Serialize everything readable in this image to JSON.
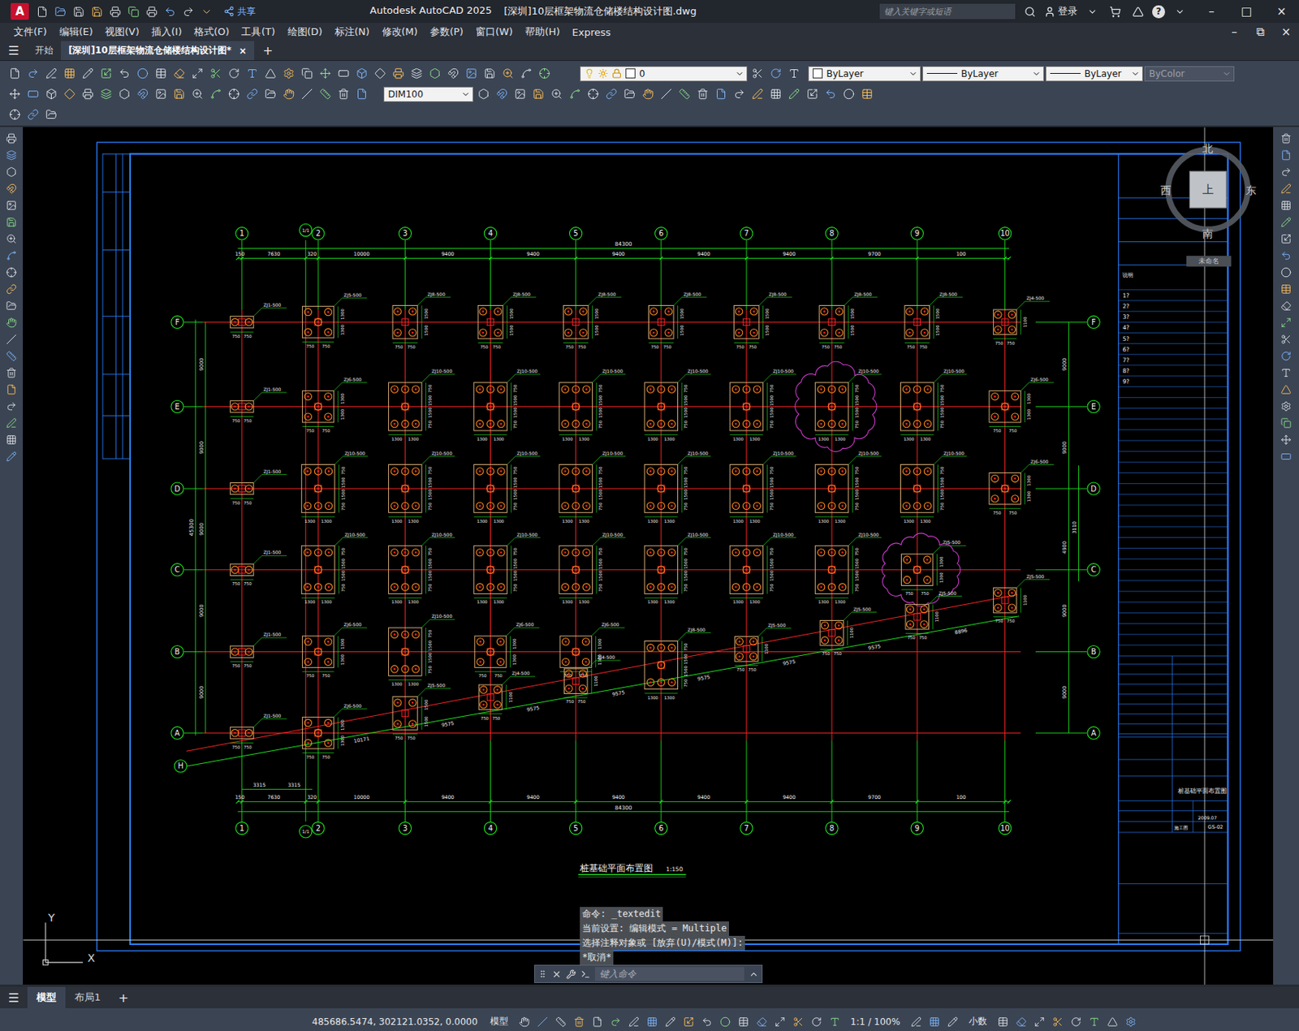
{
  "window": {
    "logo": "A",
    "app": "Autodesk AutoCAD 2025",
    "title": "[深圳]10层框架物流仓储楼结构设计图.dwg",
    "share": "共享",
    "search_placeholder": "键入关键字或短语",
    "login": "登录",
    "help": "?",
    "controls": [
      "–",
      "□",
      "×"
    ]
  },
  "menu": {
    "items": [
      "文件(F)",
      "编辑(E)",
      "视图(V)",
      "插入(I)",
      "格式(O)",
      "工具(T)",
      "绘图(D)",
      "标注(N)",
      "修改(M)",
      "参数(P)",
      "窗口(W)",
      "帮助(H)",
      "Express"
    ],
    "controls": [
      "–",
      "⧉",
      "×"
    ]
  },
  "doc_tabs": {
    "menu_glyph": "☰",
    "tabs": [
      {
        "label": "开始",
        "selected": false,
        "closable": false
      },
      {
        "label": "[深圳]10层框架物流仓储楼结构设计图*",
        "selected": true,
        "closable": true
      }
    ],
    "close_glyph": "×",
    "add_glyph": "+"
  },
  "properties": {
    "layer": "0",
    "color": "ByLayer",
    "linetype": "ByLayer",
    "lineweight": "ByLayer",
    "plot_style": {
      "label": "ByColor",
      "disabled": true
    },
    "dim_style": "DIM100"
  },
  "drawing": {
    "columns": [
      "1",
      "1/1",
      "2",
      "3",
      "4",
      "5",
      "6",
      "7",
      "8",
      "9",
      "10"
    ],
    "rows": [
      "F",
      "E",
      "D",
      "C",
      "B",
      "A"
    ],
    "slope_row": "H",
    "top_total": "84300",
    "top_dims": [
      "150",
      "7630",
      "320",
      "10000",
      "9400",
      "9400",
      "9400",
      "9400",
      "9400",
      "9700",
      "100"
    ],
    "bottom_total": "84300",
    "bottom_dims": [
      "150",
      "7630",
      "320",
      "10000",
      "9400",
      "9400",
      "9400",
      "9400",
      "9400",
      "9700",
      "100"
    ],
    "bottom_extra": [
      "3315",
      "3315"
    ],
    "left_total": "45300",
    "left_dims": [
      "9000",
      "9000",
      "9000",
      "9000",
      "9000"
    ],
    "right_dims": [
      "9000",
      "9000",
      "4900",
      "9000",
      "9000"
    ],
    "right_extra": "3110",
    "slope_dims": [
      "10171",
      "9575",
      "9575",
      "9575",
      "9575",
      "9575",
      "9575",
      "8896"
    ],
    "title": "桩基础平面布置图",
    "scale": "1:150",
    "cap_types": {
      "small": {
        "bottom": [
          "750",
          "750"
        ],
        "side": []
      },
      "four": {
        "bottom": [
          "750",
          "750"
        ],
        "side": [
          "1500",
          "1500"
        ]
      },
      "sq": {
        "bottom": [
          "750",
          "750"
        ],
        "side": [
          "1300",
          "1300"
        ]
      },
      "tall": {
        "bottom": [
          "1300",
          "1300"
        ],
        "side": [
          "750",
          "1500",
          "1500",
          "750"
        ]
      },
      "small4": {
        "bottom": [
          "750",
          "750"
        ],
        "side": [
          "1100"
        ]
      }
    },
    "caps": [
      {
        "col": "1",
        "row": "F",
        "kind": "small",
        "label": "ZJ1-500",
        "marked": false
      },
      {
        "col": "2",
        "row": "F",
        "kind": "sq",
        "label": "ZJ5-500",
        "marked": false
      },
      {
        "col": "3",
        "row": "F",
        "kind": "four",
        "label": "ZJ8-500",
        "marked": false
      },
      {
        "col": "4",
        "row": "F",
        "kind": "four",
        "label": "ZJ8-500",
        "marked": false
      },
      {
        "col": "5",
        "row": "F",
        "kind": "four",
        "label": "ZJ8-500",
        "marked": false
      },
      {
        "col": "6",
        "row": "F",
        "kind": "four",
        "label": "ZJ8-500",
        "marked": false
      },
      {
        "col": "7",
        "row": "F",
        "kind": "four",
        "label": "ZJ8-500",
        "marked": false
      },
      {
        "col": "8",
        "row": "F",
        "kind": "four",
        "label": "ZJ8-500",
        "marked": false
      },
      {
        "col": "9",
        "row": "F",
        "kind": "four",
        "label": "ZJ8-500",
        "marked": false
      },
      {
        "col": "10",
        "row": "F",
        "kind": "small4",
        "label": "ZJ4-500",
        "marked": false
      },
      {
        "col": "1",
        "row": "E",
        "kind": "small",
        "label": "ZJ1-500",
        "marked": false
      },
      {
        "col": "2",
        "row": "E",
        "kind": "sq",
        "label": "ZJ6-500",
        "marked": false
      },
      {
        "col": "3",
        "row": "E",
        "kind": "tall",
        "label": "ZJ10-500",
        "marked": false
      },
      {
        "col": "4",
        "row": "E",
        "kind": "tall",
        "label": "ZJ10-500",
        "marked": false
      },
      {
        "col": "5",
        "row": "E",
        "kind": "tall",
        "label": "ZJ10-500",
        "marked": false
      },
      {
        "col": "6",
        "row": "E",
        "kind": "tall",
        "label": "ZJ10-500",
        "marked": false
      },
      {
        "col": "7",
        "row": "E",
        "kind": "tall",
        "label": "ZJ10-500",
        "marked": false
      },
      {
        "col": "8",
        "row": "E",
        "kind": "tall",
        "label": "ZJ10-500",
        "marked": true
      },
      {
        "col": "9",
        "row": "E",
        "kind": "tall",
        "label": "ZJ10-500",
        "marked": false
      },
      {
        "col": "10",
        "row": "E",
        "kind": "sq",
        "label": "ZJ6-500",
        "marked": false
      },
      {
        "col": "1",
        "row": "D",
        "kind": "small",
        "label": "ZJ1-500",
        "marked": false
      },
      {
        "col": "2",
        "row": "D",
        "kind": "tall",
        "label": "ZJ10-500",
        "marked": false
      },
      {
        "col": "3",
        "row": "D",
        "kind": "tall",
        "label": "ZJ10-500",
        "marked": false
      },
      {
        "col": "4",
        "row": "D",
        "kind": "tall",
        "label": "ZJ10-500",
        "marked": false
      },
      {
        "col": "5",
        "row": "D",
        "kind": "tall",
        "label": "ZJ10-500",
        "marked": false
      },
      {
        "col": "6",
        "row": "D",
        "kind": "tall",
        "label": "ZJ10-500",
        "marked": false
      },
      {
        "col": "7",
        "row": "D",
        "kind": "tall",
        "label": "ZJ10-500",
        "marked": false
      },
      {
        "col": "8",
        "row": "D",
        "kind": "tall",
        "label": "ZJ10-500",
        "marked": false
      },
      {
        "col": "9",
        "row": "D",
        "kind": "tall",
        "label": "ZJ10-500",
        "marked": false
      },
      {
        "col": "10",
        "row": "D",
        "kind": "sq",
        "label": "ZJ6-500",
        "marked": false
      },
      {
        "col": "1",
        "row": "C",
        "kind": "small",
        "label": "ZJ1-500",
        "marked": false
      },
      {
        "col": "2",
        "row": "C",
        "kind": "tall",
        "label": "ZJ10-500",
        "marked": false
      },
      {
        "col": "3",
        "row": "C",
        "kind": "tall",
        "label": "ZJ10-500",
        "marked": false
      },
      {
        "col": "4",
        "row": "C",
        "kind": "tall",
        "label": "ZJ10-500",
        "marked": false
      },
      {
        "col": "5",
        "row": "C",
        "kind": "tall",
        "label": "ZJ10-500",
        "marked": false
      },
      {
        "col": "6",
        "row": "C",
        "kind": "tall",
        "label": "ZJ10-500",
        "marked": false
      },
      {
        "col": "7",
        "row": "C",
        "kind": "tall",
        "label": "ZJ10-500",
        "marked": false
      },
      {
        "col": "8",
        "row": "C",
        "kind": "tall",
        "label": "ZJ10-500",
        "marked": false
      },
      {
        "col": "9",
        "row": "C",
        "kind": "sq",
        "label": "ZJ5-500",
        "marked": true
      },
      {
        "col": "10",
        "row": "H",
        "kind": "small4",
        "label": "ZJ5-500",
        "marked": false
      },
      {
        "col": "1",
        "row": "B",
        "kind": "small",
        "label": "ZJ1-500",
        "marked": false
      },
      {
        "col": "2",
        "row": "B",
        "kind": "sq",
        "label": "ZJ6-500",
        "marked": false
      },
      {
        "col": "3",
        "row": "B",
        "kind": "tall",
        "label": "ZJ10-500",
        "marked": false
      },
      {
        "col": "4",
        "row": "B",
        "kind": "sq",
        "label": "ZJ6-500",
        "marked": false
      },
      {
        "col": "5",
        "row": "B",
        "kind": "sq",
        "label": "ZJ6-500",
        "marked": false
      },
      {
        "col": "6",
        "row": "H",
        "kind": "tall",
        "label": "ZJ8-500",
        "marked": false
      },
      {
        "col": "7",
        "row": "H",
        "kind": "small4",
        "label": "ZJ5-500",
        "marked": false
      },
      {
        "col": "8",
        "row": "H",
        "kind": "small4",
        "label": "ZJ5-500",
        "marked": false
      },
      {
        "col": "9",
        "row": "H",
        "kind": "small4",
        "label": "ZJ5-500",
        "marked": false
      },
      {
        "col": "3",
        "row": "H",
        "kind": "four",
        "label": "ZJ5-500",
        "marked": false
      },
      {
        "col": "4",
        "row": "H",
        "kind": "small4",
        "label": "ZJ4-500",
        "marked": false
      },
      {
        "col": "5",
        "row": "H",
        "kind": "small4",
        "label": "ZJ4-500",
        "marked": false
      },
      {
        "col": "1",
        "row": "A",
        "kind": "small",
        "label": "ZJ1-500",
        "marked": false
      },
      {
        "col": "2",
        "row": "A",
        "kind": "sq",
        "label": "ZJ6-500",
        "marked": false
      }
    ],
    "title_block": {
      "notes_title": "说明",
      "notes": [
        "1?",
        "2?",
        "3?",
        "4?",
        "5?",
        "6?",
        "7?",
        "8?",
        "9?"
      ],
      "drawing_name": "桩基础平面布置图",
      "stage": "施工图",
      "date": "2009.07",
      "number": "GS-02"
    }
  },
  "viewcube": {
    "top": "上",
    "north": "北",
    "south": "南",
    "east": "东",
    "west": "西",
    "ucs": "未命名"
  },
  "ucs_icon": {
    "x": "X",
    "y": "Y"
  },
  "command_line": {
    "history": [
      "命令: _textedit",
      "当前设置: 编辑模式 = Multiple",
      "选择注释对象或 [放弃(U)/模式(M)]:",
      "*取消*"
    ],
    "placeholder": "键入命令"
  },
  "layout_tabs": {
    "menu_glyph": "☰",
    "tabs": [
      {
        "label": "模型",
        "selected": true
      },
      {
        "label": "布局1",
        "selected": false
      }
    ],
    "add_glyph": "+"
  },
  "status_bar": {
    "coords": "485686.5474, 302121.0352, 0.0000",
    "space": "模型",
    "scale": "1:1 / 100%",
    "units": "小数"
  }
}
